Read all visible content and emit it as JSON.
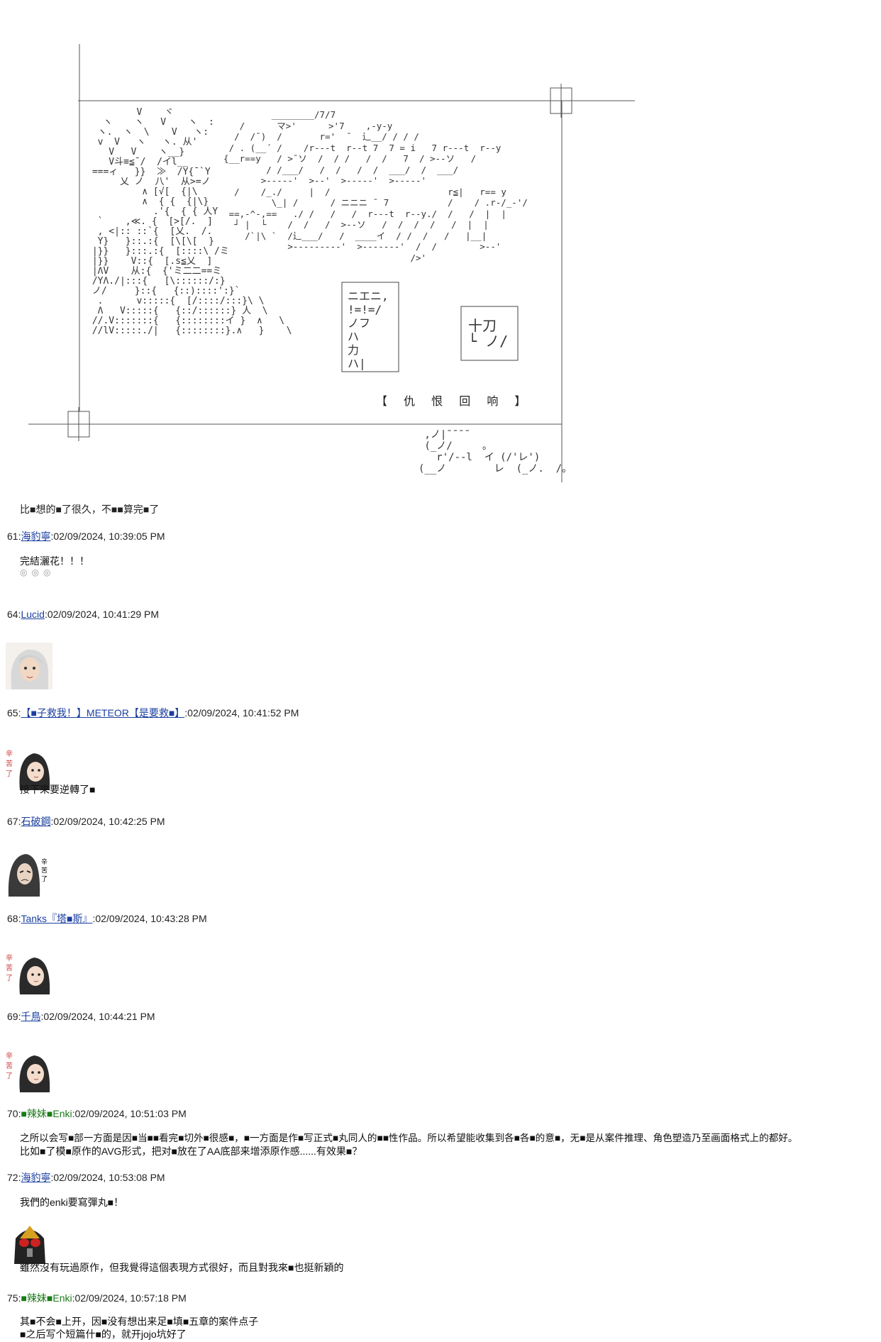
{
  "art": {
    "subtitle": "【 仇 恨 回 响 】",
    "lines_left": [
      "         V    ヾ",
      "   ヽ    ヽ   V    ヽ  :",
      "  ヽ.  ヽ  \\    V   ヽ:",
      "  v  V   ヽ   ヽ. 从'  ",
      "    V   V    ヽ__}   ",
      "    V斗≡≦¯/  /イl__",
      " ===ィ   }}  ≫  /Y{¯`Y",
      "      乂 ノ  八'  从>=ノ",
      "          ∧ [√[  {|\\",
      "          ∧  { {  {|\\}",
      "            .'{  { { 人Y",
      "  `    ,≪. {  [>[/.  ]",
      "  , <|:: ::`{  [乂.  /.",
      "  Y}   }::.:{  [\\[\\[  }",
      " |}}   }:::.:{  [::::\\ /ミ",
      " |}}    V::{  [.s≦乂  ]",
      " |ΛV    从:{  {'ミ二二==ミ",
      " /YΛ./|:::{   [\\::::::/:}",
      " ノ/     }::{   {::)::::':}`",
      "  .      v:::::{  [/::::/:::}\\ \\",
      "  Λ   V:::::{   {::/::::::} 人  \\",
      " //.V:::::::{   {::::::::イ }  ∧   \\",
      " //lV:::::./|   {::::::::}.∧   }    \\"
    ],
    "lines_right": [
      "           ________/7/7",
      "     /      マ>'      >'7    ,-y-y",
      "    /  /¯)  /       r='  ̄   辶__/ / / /",
      "   / . (__´ /    /r---t  r--t 7  7 = i   7 r---t  r--y",
      "  {__r==y   / >¯ソ  /  / /   /  /   7  / >--ソ   /",
      "          / /___/   /  /   /  /  ___/  /  ___/",
      "         >-----'  >--'  >-----'  >-----'",
      "    /    /_./     |  /                      r≦|   r== y",
      "           \\_| /      / ニニニ ¯ 7           /    / .r-/_-'/",
      "   ==,-^-,==   ./ /   /   /  r---t  r--y./  /   /  |  |",
      "    ┘ |  └    /  /   /  >--ソ   /  /  /  /   /  |  |",
      "      /`|\\ `  /辶___/   /  ____イ  / /  /   /   |__|",
      "              >---------'  >-------'  /  /        >--'",
      "                                     />'"
    ],
    "box1": [
      "ニエニ,",
      "!=!=/",
      "ノフ",
      "ハ",
      "力",
      "ハ|"
    ],
    "box2": [
      "十刀",
      "└ ノ/"
    ],
    "signature": [
      " ,ノ|¯¯¯¯",
      " (_ノ/     。",
      "   r'/--l  イ (/'レ')",
      "(__ノ        レ  (_ノ.  /。"
    ]
  },
  "intro": "比■想的■了很久，不■■算完■了",
  "posts": [
    {
      "num": "61:",
      "author": "海豹寧",
      "time": ":02/09/2024, 10:39:05 PM",
      "body": "完結灑花！！！",
      "extra": "◎◎◎"
    },
    {
      "num": "64:",
      "author": "Lucid",
      "time": ":02/09/2024, 10:41:29 PM"
    },
    {
      "num": "65:",
      "author": "【■子救我！】METEOR【是要救■】",
      "time": ":02/09/2024, 10:41:52 PM",
      "body": "接下來要逆轉了■"
    },
    {
      "num": "67:",
      "author": "石破鋼",
      "time": ":02/09/2024, 10:42:25 PM"
    },
    {
      "num": "68:",
      "author": "Tanks『塔■斯』",
      "time": ":02/09/2024, 10:43:28 PM"
    },
    {
      "num": "69:",
      "author": "千鳥",
      "time": ":02/09/2024, 10:44:21 PM"
    },
    {
      "num": "70:",
      "author": "■辣妹■Enki",
      "time": ":02/09/2024, 10:51:03 PM",
      "body": "之所以会写■部一方面是因■当■■看完■切外■很感■，■一方面是作■写正式■丸同人的■■性作品。所以希望能收集到各■各■的意■，无■是从案件推理、角色塑造乃至画面格式上的都好。",
      "body2": "比如■了模■原作的AVG形式，把对■放在了AA底部来增添原作感......有效果■？"
    },
    {
      "num": "72:",
      "author": "海豹寧",
      "time": ":02/09/2024, 10:53:08 PM",
      "body": "我們的enki要寫彈丸■！",
      "body2": "雖然沒有玩過原作，但我覺得這個表現方式很好，而且對我來■也挺新穎的"
    },
    {
      "num": "75:",
      "author": "■辣妹■Enki",
      "time": ":02/09/2024, 10:57:18 PM",
      "body": "其■不会■上开，因■没有想出来足■填■五章的案件点子",
      "body2": "■之后写个短篇什■的，就开jojo坑好了"
    }
  ],
  "avatars": {
    "a1": "white-haired-girl-avatar",
    "a2": "black-haired-girl-avatar",
    "a3": "long-haired-man-avatar",
    "a4": "masked-rider-avatar"
  },
  "avatar_caption": "辛苦了"
}
